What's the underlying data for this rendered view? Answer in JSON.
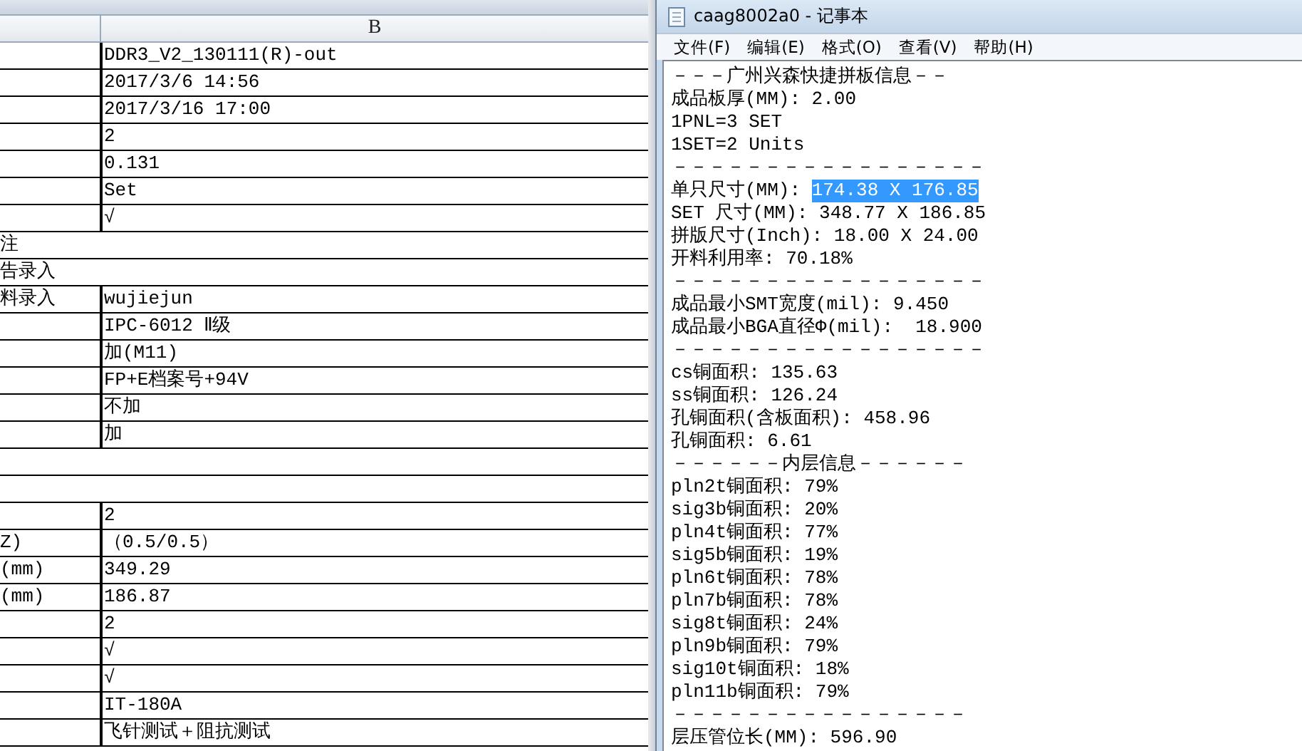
{
  "sheet": {
    "column_header": "B",
    "rows": [
      {
        "kind": "pair",
        "a": "",
        "b": "DDR3_V2_130111(R)-out"
      },
      {
        "kind": "pair",
        "a": "",
        "b": "2017/3/6 14:56"
      },
      {
        "kind": "pair",
        "a": "",
        "b": "2017/3/16 17:00"
      },
      {
        "kind": "pair",
        "a": "",
        "b": "2"
      },
      {
        "kind": "pair",
        "a": "",
        "b": "0.131"
      },
      {
        "kind": "pair",
        "a": "",
        "b": "Set"
      },
      {
        "kind": "pair",
        "a": "",
        "b": "√"
      },
      {
        "kind": "merged",
        "a": "注"
      },
      {
        "kind": "merged",
        "a": "告录入"
      },
      {
        "kind": "pair",
        "a": "料录入",
        "b": "wujiejun"
      },
      {
        "kind": "pair",
        "a": "",
        "b": "IPC-6012 Ⅱ级"
      },
      {
        "kind": "pair",
        "a": "",
        "b": "加(M11)"
      },
      {
        "kind": "pair",
        "a": "",
        "b": "FP+E档案号+94V"
      },
      {
        "kind": "pair",
        "a": "",
        "b": "不加"
      },
      {
        "kind": "pair",
        "a": "",
        "b": "加"
      },
      {
        "kind": "merged",
        "a": ""
      },
      {
        "kind": "merged",
        "a": ""
      },
      {
        "kind": "pair",
        "a": "",
        "b": "2"
      },
      {
        "kind": "pair",
        "a": "Z)",
        "b": "（0.5/0.5）"
      },
      {
        "kind": "pair",
        "a": "(mm)",
        "b": "349.29"
      },
      {
        "kind": "pair",
        "a": "(mm)",
        "b": "186.87"
      },
      {
        "kind": "pair",
        "a": "",
        "b": "2"
      },
      {
        "kind": "pair",
        "a": "",
        "b": "√"
      },
      {
        "kind": "pair",
        "a": "",
        "b": "√"
      },
      {
        "kind": "pair",
        "a": "",
        "b": "IT-180A"
      },
      {
        "kind": "pair",
        "a": "",
        "b": "飞针测试＋阻抗测试"
      }
    ]
  },
  "notepad": {
    "title": "caag8002a0 - 记事本",
    "menu": [
      "文件(F)",
      "编辑(E)",
      "格式(O)",
      "查看(V)",
      "帮助(H)"
    ],
    "lines": [
      {
        "text": "－－－广州兴森快捷拼板信息－－"
      },
      {
        "text": "成品板厚(MM): 2.00"
      },
      {
        "text": "1PNL=3 SET"
      },
      {
        "text": "1SET=2 Units"
      },
      {
        "text": "－－－－－－－－－－－－－－－－－"
      },
      {
        "text": "单只尺寸(MM): ",
        "selection": "174.38 X 176.85"
      },
      {
        "text": "SET 尺寸(MM): 348.77 X 186.85"
      },
      {
        "text": "拼版尺寸(Inch): 18.00 X 24.00"
      },
      {
        "text": "开料利用率: 70.18%"
      },
      {
        "text": "－－－－－－－－－－－－－－－－－"
      },
      {
        "text": "成品最小SMT宽度(mil): 9.450"
      },
      {
        "text": "成品最小BGA直径Φ(mil):  18.900"
      },
      {
        "text": "－－－－－－－－－－－－－－－－－"
      },
      {
        "text": "cs铜面积: 135.63"
      },
      {
        "text": "ss铜面积: 126.24"
      },
      {
        "text": "孔铜面积(含板面积): 458.96"
      },
      {
        "text": "孔铜面积: 6.61"
      },
      {
        "text": "－－－－－－内层信息－－－－－－"
      },
      {
        "text": "pln2t铜面积: 79%"
      },
      {
        "text": "sig3b铜面积: 20%"
      },
      {
        "text": "pln4t铜面积: 77%"
      },
      {
        "text": "sig5b铜面积: 19%"
      },
      {
        "text": "pln6t铜面积: 78%"
      },
      {
        "text": "pln7b铜面积: 78%"
      },
      {
        "text": "sig8t铜面积: 24%"
      },
      {
        "text": "pln9b铜面积: 79%"
      },
      {
        "text": "sig10t铜面积: 18%"
      },
      {
        "text": "pln11b铜面积: 79%"
      },
      {
        "text": "－－－－－－－－－－－－－－－－"
      },
      {
        "text": "层压管位长(MM): 596.90"
      }
    ]
  }
}
